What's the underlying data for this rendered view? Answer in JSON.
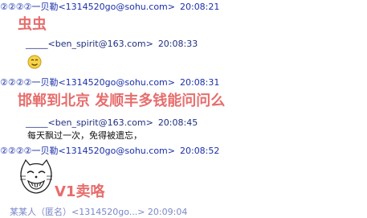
{
  "messages": [
    {
      "sender": "②②②②一贝勒<1314520go@sohu.com>",
      "time": "20:08:21",
      "text": "虫虫"
    },
    {
      "sender": "_____<ben_spirit@163.com>",
      "time": "20:08:33",
      "text": ""
    },
    {
      "sender": "②②②②一贝勒<1314520go@sohu.com>",
      "time": "20:08:31",
      "text": "邯郸到北京 发顺丰多钱能问问么"
    },
    {
      "sender": "_____<ben_spirit@163.com>",
      "time": "20:08:45",
      "text": "每天飘过一次，免得被遗忘，"
    },
    {
      "sender": "②②②②一贝勒<1314520go@sohu.com>",
      "time": "20:08:52",
      "text": "V1卖咯"
    }
  ],
  "cut_off_line": "某某人（匿名）<1314520go...> 20:09:04",
  "colors": {
    "self": "#1a2fa8",
    "other": "#1f2f7f",
    "big_text": "#e76d6d"
  },
  "icons": [
    "smiley-icon",
    "cat-face-sticker"
  ]
}
